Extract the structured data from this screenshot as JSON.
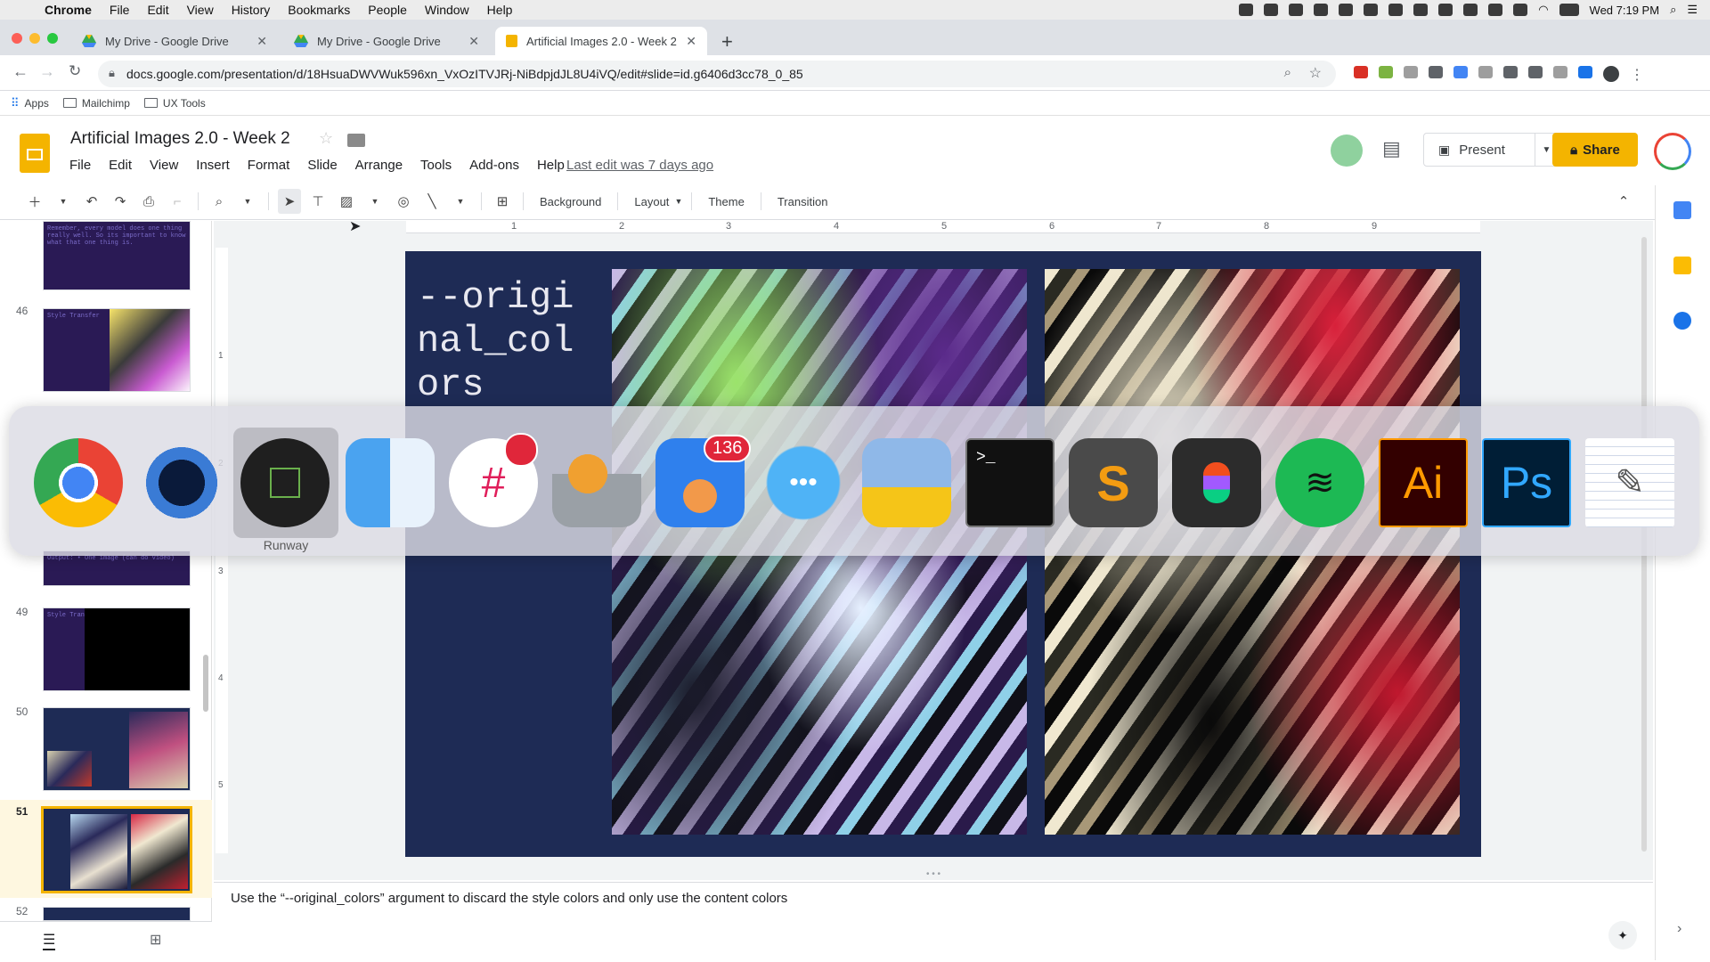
{
  "menubar": {
    "app": "Chrome",
    "items": [
      "File",
      "Edit",
      "View",
      "History",
      "Bookmarks",
      "People",
      "Window",
      "Help"
    ],
    "clock": "Wed 7:19 PM"
  },
  "tabs": [
    {
      "title": "My Drive - Google Drive"
    },
    {
      "title": "My Drive - Google Drive"
    },
    {
      "title": "Artificial Images 2.0 - Week 2"
    }
  ],
  "address": {
    "url": "docs.google.com/presentation/d/18HsuaDWVWuk596xn_VxOzITVJRj-NiBdpjdJL8U4iVQ/edit#slide=id.g6406d3cc78_0_85"
  },
  "bookmarks": [
    "Apps",
    "Mailchimp",
    "UX Tools"
  ],
  "doc": {
    "title": "Artificial Images 2.0 - Week 2",
    "menu": [
      "File",
      "Edit",
      "View",
      "Insert",
      "Format",
      "Slide",
      "Arrange",
      "Tools",
      "Add-ons",
      "Help"
    ],
    "last_edit": "Last edit was 7 days ago",
    "present": "Present",
    "share": "Share"
  },
  "toolbar": {
    "background": "Background",
    "layout": "Layout",
    "theme": "Theme",
    "transition": "Transition"
  },
  "filmstrip": {
    "numbers": [
      "46",
      "49",
      "50",
      "51",
      "52"
    ],
    "thumb_texts": [
      "Remember, every model does one thing really well. So its important to know what that one thing is.",
      "Style Transfer",
      "Output: • One image (can do video)",
      "Style Transfer"
    ]
  },
  "ruler": {
    "marks": [
      "1",
      "2",
      "3",
      "4",
      "5",
      "6",
      "7",
      "8",
      "9"
    ],
    "vmarks": [
      "1",
      "2",
      "3",
      "4",
      "5"
    ]
  },
  "slide": {
    "text": "--origi\nnal_col\nors"
  },
  "notes": {
    "text": "Use the “--original_colors” argument to discard the style colors and only use the content colors"
  },
  "dock": {
    "hover_label": "Runway",
    "badges": {
      "slack": "",
      "tweetbot": "136"
    }
  },
  "colors": {
    "slides_yellow": "#f4b400",
    "slide_bg": "#1e2b55",
    "filmstrip_selected": "#fef7e0"
  }
}
